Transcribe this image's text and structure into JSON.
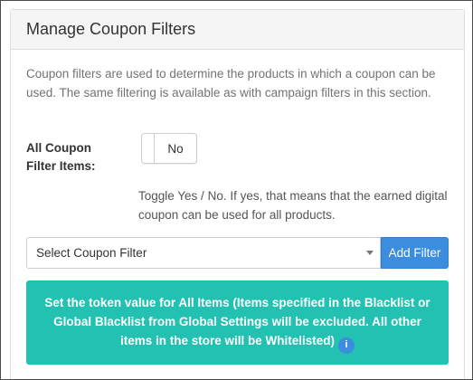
{
  "panel": {
    "title": "Manage Coupon Filters",
    "description": "Coupon filters are used to determine the products in which a coupon can be used. The same filtering is available as with campaign filters in this section."
  },
  "all_items": {
    "label_line1": "All Coupon",
    "label_line2": "Filter Items:",
    "toggle_value": "No",
    "help_text": "Toggle Yes / No. If yes, that means that the earned digital coupon can be used for all products."
  },
  "filter_select": {
    "selected": "Select Coupon Filter",
    "add_button": "Add Filter"
  },
  "callout": {
    "text": "Set the token value for All Items (Items specified in the Blacklist or Global Blacklist from Global Settings will be excluded. All other items in the store will be Whitelisted)",
    "icon_glyph": "i",
    "bg_color": "#22c1b2"
  },
  "colors": {
    "primary": "#3c8dde",
    "header_bg": "#f5f5f5",
    "teal": "#22c1b2"
  }
}
